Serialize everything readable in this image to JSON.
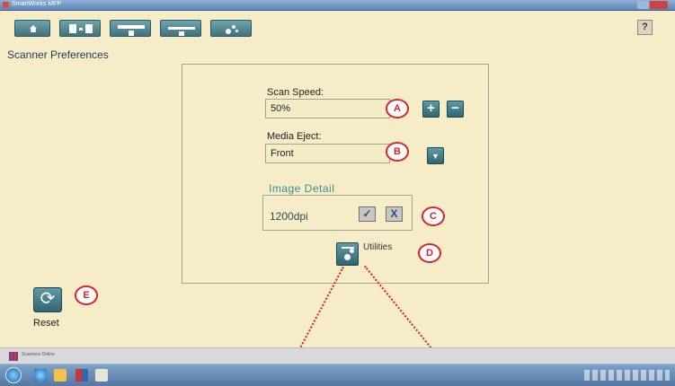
{
  "window": {
    "title": "SmartWorks MFP"
  },
  "toolbar": {
    "buttons": [
      {
        "icon": "home-icon"
      },
      {
        "icon": "copy-icon"
      },
      {
        "icon": "scan-icon"
      },
      {
        "icon": "print-icon"
      },
      {
        "icon": "settings-icon"
      }
    ],
    "help_label": "?"
  },
  "page": {
    "title": "Scanner Preferences"
  },
  "scan_speed": {
    "label": "Scan Speed:",
    "value": "50%",
    "plus": "+",
    "minus": "−",
    "callout": "A"
  },
  "media_eject": {
    "label": "Media Eject:",
    "value": "Front",
    "callout": "B"
  },
  "image_detail": {
    "title": "Image Detail",
    "value": "1200dpi",
    "accept": "✓",
    "reject": "X",
    "callout": "C"
  },
  "utilities": {
    "label": "Utilities",
    "callout": "D"
  },
  "reset": {
    "label": "Reset",
    "callout": "E"
  },
  "status": {
    "text": "Scanners Online"
  },
  "colors": {
    "background": "#f6ecc8",
    "button": "#3f7480",
    "callout": "#d9232b",
    "accent_text": "#3a8f8a"
  }
}
